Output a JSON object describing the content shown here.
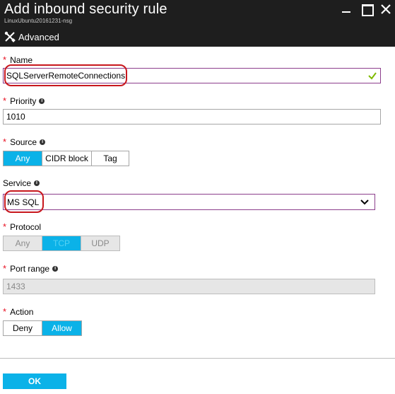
{
  "window": {
    "title": "Add inbound security rule",
    "subtitle": "LinuxUbuntu20161231-nsg",
    "advanced_label": "Advanced"
  },
  "form": {
    "name": {
      "label": "Name",
      "required": "*",
      "value": "SQLServerRemoteConnections",
      "valid": true
    },
    "priority": {
      "label": "Priority",
      "required": "*",
      "value": "1010"
    },
    "source": {
      "label": "Source",
      "required": "*",
      "options": [
        "Any",
        "CIDR block",
        "Tag"
      ],
      "selected": "Any"
    },
    "service": {
      "label": "Service",
      "value": "MS SQL"
    },
    "protocol": {
      "label": "Protocol",
      "required": "*",
      "options": [
        "Any",
        "TCP",
        "UDP"
      ],
      "selected": "TCP",
      "disabled": true
    },
    "port_range": {
      "label": "Port range",
      "required": "*",
      "value": "1433",
      "disabled": true
    },
    "action": {
      "label": "Action",
      "required": "*",
      "options": [
        "Deny",
        "Allow"
      ],
      "selected": "Allow"
    }
  },
  "footer": {
    "ok_label": "OK"
  },
  "colors": {
    "header_bg": "#1e1e1e",
    "accent": "#0bb2e8",
    "required": "#e81123",
    "valid_check": "#7fba00",
    "annotation": "#c8171d"
  },
  "icons": {
    "advanced": "wrench-screwdriver-icon",
    "info": "info-icon",
    "check": "check-icon",
    "chevron": "chevron-down-icon"
  }
}
